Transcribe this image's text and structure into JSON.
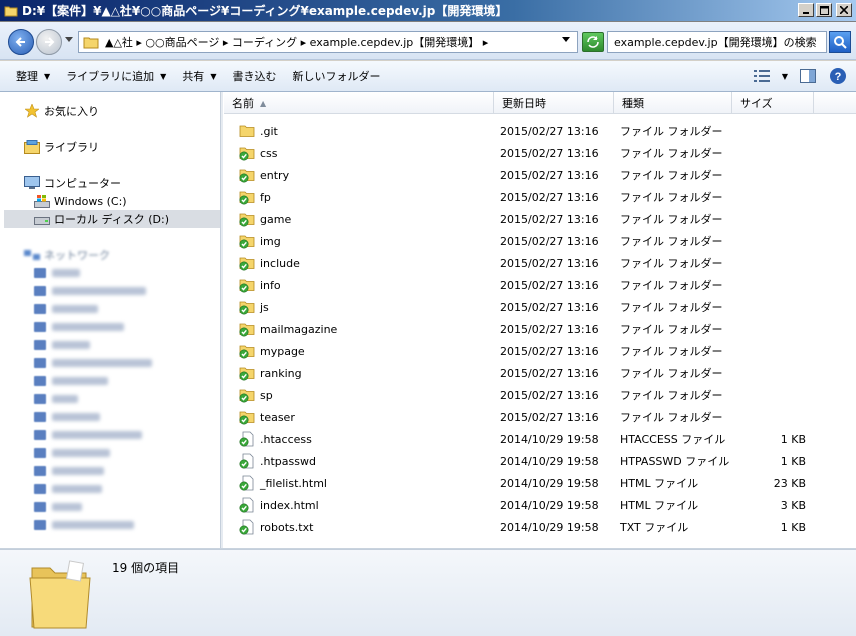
{
  "window": {
    "title": "D:¥【案件】¥▲△社¥○○商品ページ¥コーディング¥example.cepdev.jp【開発環境】"
  },
  "address": {
    "path": "▲△社 ▸ ○○商品ページ ▸ コーディング ▸ example.cepdev.jp【開発環境】 ▸",
    "search_placeholder": "example.cepdev.jp【開発環境】の検索"
  },
  "toolbar": {
    "organize": "整理",
    "add_to_library": "ライブラリに追加",
    "share": "共有",
    "burn": "書き込む",
    "new_folder": "新しいフォルダー"
  },
  "nav": {
    "favorites": "お気に入り",
    "libraries": "ライブラリ",
    "computer": "コンピューター",
    "drive_c": "Windows (C:)",
    "drive_d": "ローカル ディスク (D:)",
    "network": "ネットワーク"
  },
  "columns": {
    "name": "名前",
    "date": "更新日時",
    "type": "種類",
    "size": "サイズ"
  },
  "files": [
    {
      "name": ".git",
      "date": "2015/02/27 13:16",
      "type": "ファイル フォルダー",
      "size": "",
      "kind": "folder-plain"
    },
    {
      "name": "css",
      "date": "2015/02/27 13:16",
      "type": "ファイル フォルダー",
      "size": "",
      "kind": "folder-ok"
    },
    {
      "name": "entry",
      "date": "2015/02/27 13:16",
      "type": "ファイル フォルダー",
      "size": "",
      "kind": "folder-ok"
    },
    {
      "name": "fp",
      "date": "2015/02/27 13:16",
      "type": "ファイル フォルダー",
      "size": "",
      "kind": "folder-ok"
    },
    {
      "name": "game",
      "date": "2015/02/27 13:16",
      "type": "ファイル フォルダー",
      "size": "",
      "kind": "folder-ok"
    },
    {
      "name": "img",
      "date": "2015/02/27 13:16",
      "type": "ファイル フォルダー",
      "size": "",
      "kind": "folder-ok"
    },
    {
      "name": "include",
      "date": "2015/02/27 13:16",
      "type": "ファイル フォルダー",
      "size": "",
      "kind": "folder-ok"
    },
    {
      "name": "info",
      "date": "2015/02/27 13:16",
      "type": "ファイル フォルダー",
      "size": "",
      "kind": "folder-ok"
    },
    {
      "name": "js",
      "date": "2015/02/27 13:16",
      "type": "ファイル フォルダー",
      "size": "",
      "kind": "folder-ok"
    },
    {
      "name": "mailmagazine",
      "date": "2015/02/27 13:16",
      "type": "ファイル フォルダー",
      "size": "",
      "kind": "folder-ok"
    },
    {
      "name": "mypage",
      "date": "2015/02/27 13:16",
      "type": "ファイル フォルダー",
      "size": "",
      "kind": "folder-ok"
    },
    {
      "name": "ranking",
      "date": "2015/02/27 13:16",
      "type": "ファイル フォルダー",
      "size": "",
      "kind": "folder-ok"
    },
    {
      "name": "sp",
      "date": "2015/02/27 13:16",
      "type": "ファイル フォルダー",
      "size": "",
      "kind": "folder-ok"
    },
    {
      "name": "teaser",
      "date": "2015/02/27 13:16",
      "type": "ファイル フォルダー",
      "size": "",
      "kind": "folder-ok"
    },
    {
      "name": ".htaccess",
      "date": "2014/10/29 19:58",
      "type": "HTACCESS ファイル",
      "size": "1 KB",
      "kind": "file-ok"
    },
    {
      "name": ".htpasswd",
      "date": "2014/10/29 19:58",
      "type": "HTPASSWD ファイル",
      "size": "1 KB",
      "kind": "file-ok"
    },
    {
      "name": "_filelist.html",
      "date": "2014/10/29 19:58",
      "type": "HTML ファイル",
      "size": "23 KB",
      "kind": "file-ok"
    },
    {
      "name": "index.html",
      "date": "2014/10/29 19:58",
      "type": "HTML ファイル",
      "size": "3 KB",
      "kind": "file-ok"
    },
    {
      "name": "robots.txt",
      "date": "2014/10/29 19:58",
      "type": "TXT ファイル",
      "size": "1 KB",
      "kind": "file-ok"
    }
  ],
  "details": {
    "count": "19 個の項目"
  },
  "colors": {
    "folder": "#f5d56b",
    "check": "#3aa83a",
    "accent": "#2a5fb5"
  }
}
